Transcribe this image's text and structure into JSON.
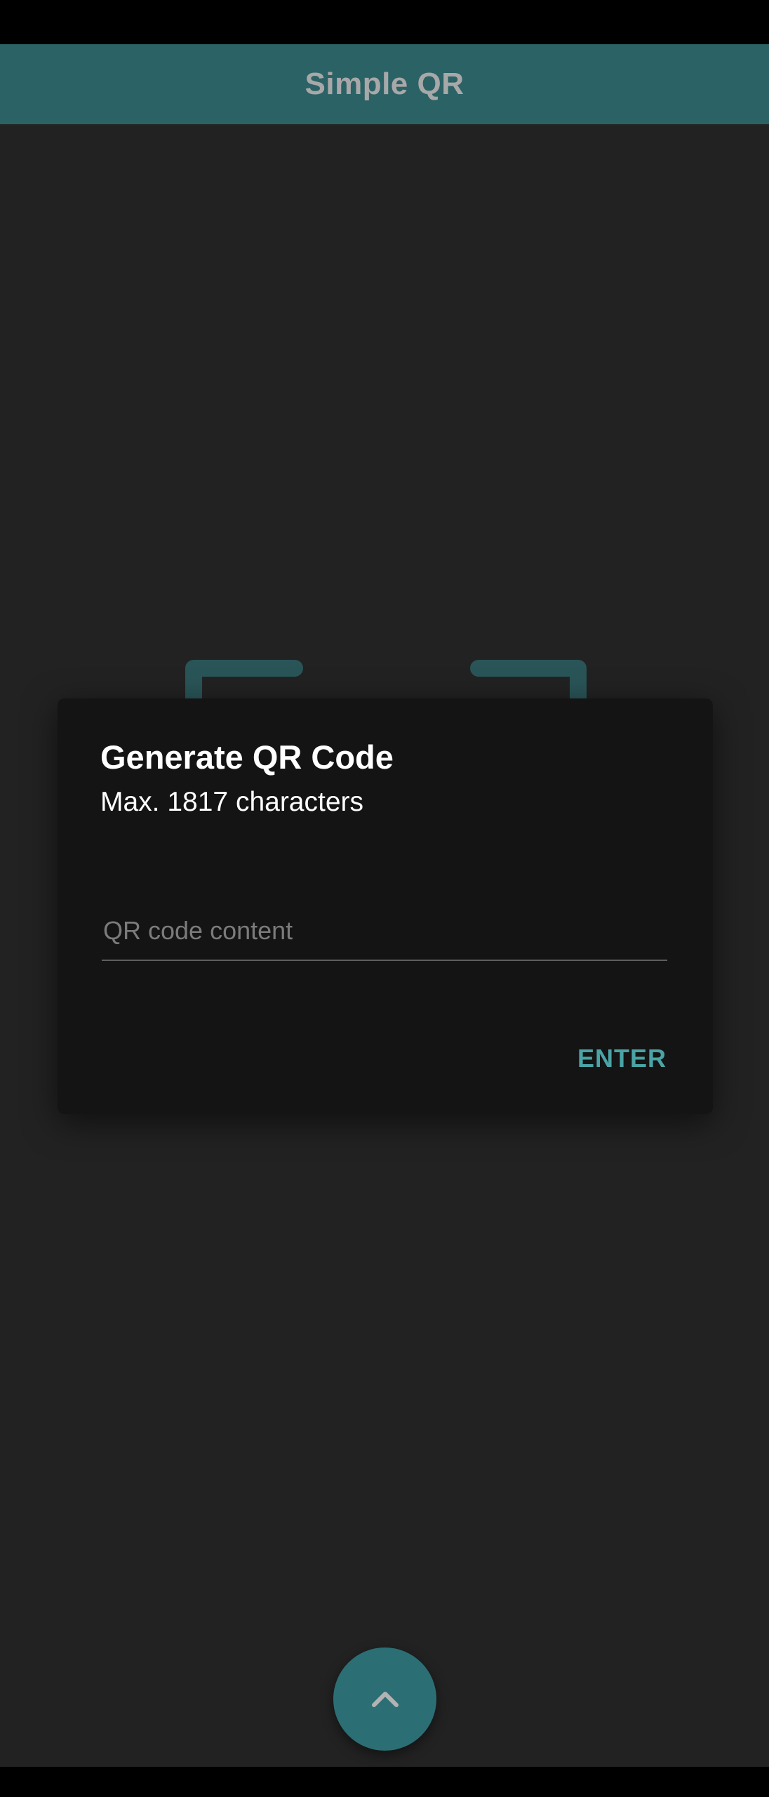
{
  "app": {
    "title": "Simple QR"
  },
  "dialog": {
    "title": "Generate QR Code",
    "subtitle": "Max. 1817 characters",
    "input_value": "",
    "input_placeholder": "QR code content",
    "enter_label": "ENTER"
  },
  "fab": {
    "icon": "chevron-up-icon"
  },
  "colors": {
    "app_bar": "#2b6266",
    "accent": "#4aa4a6",
    "background": "#222222",
    "dialog": "#141414",
    "fab": "#2b6f75",
    "scan_frame": "#2a5558"
  }
}
